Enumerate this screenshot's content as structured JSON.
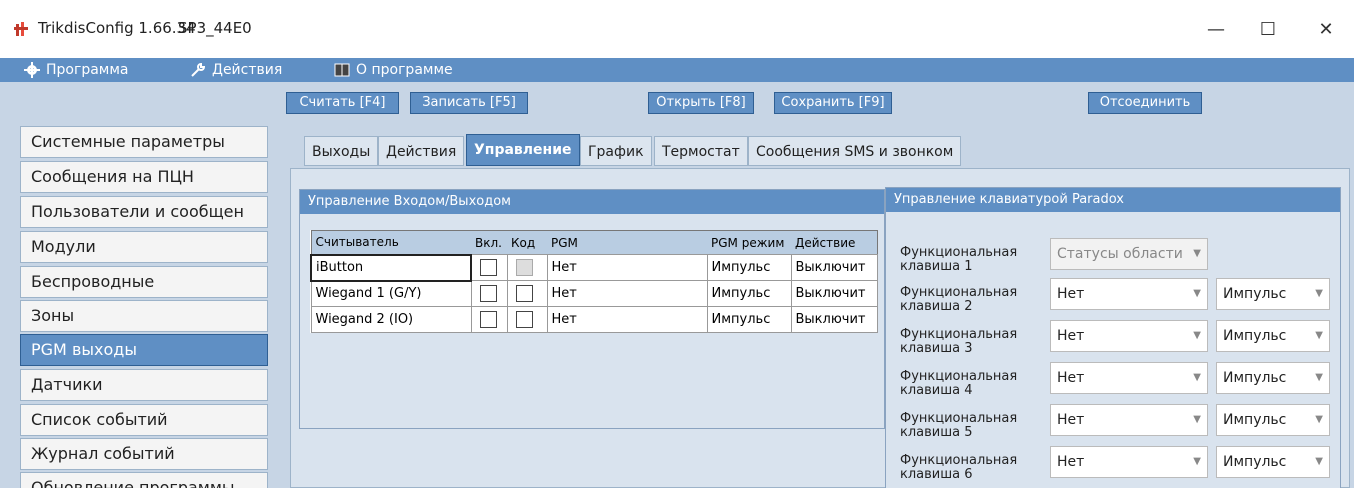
{
  "window": {
    "title": "TrikdisConfig 1.66.34",
    "device": "SP3_44E0",
    "minimize": "—",
    "maximize": "☐",
    "close": "✕"
  },
  "menu": [
    {
      "label": "Программа",
      "icon": "gear-icon"
    },
    {
      "label": "Действия",
      "icon": "wrench-icon"
    },
    {
      "label": "О программе",
      "icon": "book-icon"
    }
  ],
  "toolbar": {
    "read": "Считать [F4]",
    "write": "Записать [F5]",
    "open": "Открыть [F8]",
    "save": "Сохранить [F9]",
    "disconnect": "Отсоединить"
  },
  "sidebar": [
    {
      "label": "Системные параметры",
      "active": false
    },
    {
      "label": "Сообщения на ПЦН",
      "active": false
    },
    {
      "label": "Пользователи и сообщен",
      "active": false
    },
    {
      "label": "Модули",
      "active": false
    },
    {
      "label": "Беспроводные",
      "active": false
    },
    {
      "label": "Зоны",
      "active": false
    },
    {
      "label": "PGM выходы",
      "active": true
    },
    {
      "label": "Датчики",
      "active": false
    },
    {
      "label": "Список событий",
      "active": false
    },
    {
      "label": "Журнал событий",
      "active": false
    },
    {
      "label": "Обновление программы",
      "active": false
    }
  ],
  "tabs": [
    {
      "label": "Выходы",
      "active": false
    },
    {
      "label": "Действия",
      "active": false
    },
    {
      "label": "Управление",
      "active": true
    },
    {
      "label": "График",
      "active": false
    },
    {
      "label": "Термостат",
      "active": false
    },
    {
      "label": "Сообщения SMS и звонком",
      "active": false
    }
  ],
  "io_group": {
    "title": "Управление Входом/Выходом",
    "columns": [
      "Считыватель",
      "Вкл.",
      "Код",
      "PGM",
      "PGM режим",
      "Действие"
    ],
    "rows": [
      {
        "reader": "iButton",
        "pgm": "Нет",
        "mode": "Импульс",
        "action": "Выключит",
        "enabled": false,
        "code": false,
        "code_disabled": true
      },
      {
        "reader": "Wiegand 1 (G/Y)",
        "pgm": "Нет",
        "mode": "Импульс",
        "action": "Выключит",
        "enabled": false,
        "code": false,
        "code_disabled": false
      },
      {
        "reader": "Wiegand 2 (IO)",
        "pgm": "Нет",
        "mode": "Импульс",
        "action": "Выключит",
        "enabled": false,
        "code": false,
        "code_disabled": false
      }
    ]
  },
  "paradox_group": {
    "title": "Управление клавиатурой Paradox",
    "keys": [
      {
        "label1": "Функциональная",
        "label2": "клавиша 1",
        "value": "Статусы области",
        "mode": null,
        "disabled": true
      },
      {
        "label1": "Функциональная",
        "label2": "клавиша 2",
        "value": "Нет",
        "mode": "Импульс",
        "disabled": false
      },
      {
        "label1": "Функциональная",
        "label2": "клавиша 3",
        "value": "Нет",
        "mode": "Импульс",
        "disabled": false
      },
      {
        "label1": "Функциональная",
        "label2": "клавиша 4",
        "value": "Нет",
        "mode": "Импульс",
        "disabled": false
      },
      {
        "label1": "Функциональная",
        "label2": "клавиша 5",
        "value": "Нет",
        "mode": "Импульс",
        "disabled": false
      },
      {
        "label1": "Функциональная",
        "label2": "клавиша 6",
        "value": "Нет",
        "mode": "Импульс",
        "disabled": false
      }
    ]
  },
  "colors": {
    "accent": "#5f8fc4",
    "panel": "#c7d5e5"
  }
}
